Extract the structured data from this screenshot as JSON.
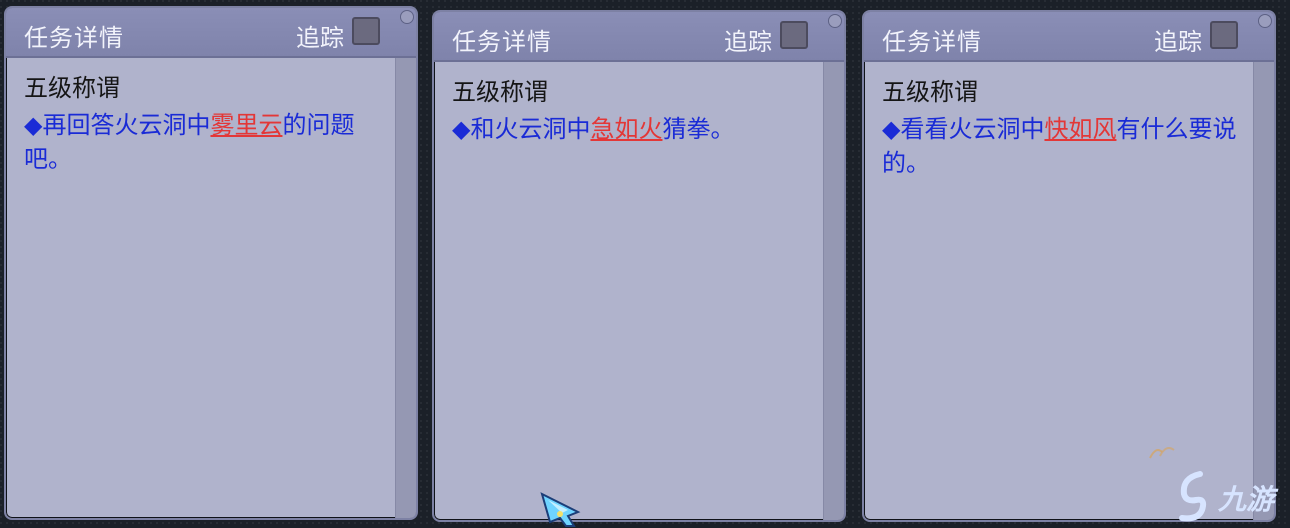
{
  "panels": [
    {
      "title": "任务详情",
      "track_label": "追踪",
      "level": "五级称谓",
      "desc_prefix": "◆再回答火云洞中",
      "npc": "雾里云",
      "desc_suffix": "的问题吧。"
    },
    {
      "title": "任务详情",
      "track_label": "追踪",
      "level": "五级称谓",
      "desc_prefix": "◆和火云洞中",
      "npc": "急如火",
      "desc_suffix": "猜拳。"
    },
    {
      "title": "任务详情",
      "track_label": "追踪",
      "level": "五级称谓",
      "desc_prefix": "◆看看火云洞中",
      "npc": "快如风",
      "desc_suffix": "有什么要说的。"
    }
  ],
  "watermark": {
    "text": "九游"
  },
  "colors": {
    "panel_bg": "#b0b3cc",
    "header_bg": "#8a8eb6",
    "desc_text": "#1a2bd6",
    "npc_text": "#e33737"
  },
  "icons": {
    "cursor": "cursor-icon",
    "checkbox": "track-checkbox",
    "watermark_logo": "jiuyou-logo-icon"
  }
}
